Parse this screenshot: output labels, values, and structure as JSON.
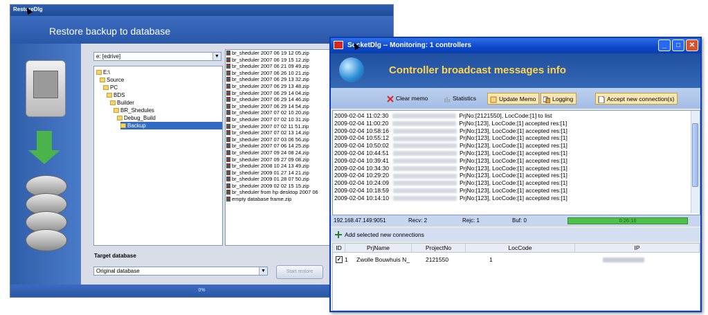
{
  "restore_window": {
    "title": "RestoreDlg",
    "header": "Restore backup to database",
    "drive_combo": "e: [edrive]",
    "tree": [
      {
        "label": "E:\\",
        "indent": 0,
        "selected": false
      },
      {
        "label": "Source",
        "indent": 1,
        "selected": false
      },
      {
        "label": "PC",
        "indent": 2,
        "selected": false
      },
      {
        "label": "BDS",
        "indent": 3,
        "selected": false
      },
      {
        "label": "Builder",
        "indent": 4,
        "selected": false
      },
      {
        "label": "BR_Shedules",
        "indent": 5,
        "selected": false
      },
      {
        "label": "Debug_Build",
        "indent": 6,
        "selected": false
      },
      {
        "label": "Backup",
        "indent": 7,
        "selected": true
      }
    ],
    "files": [
      "br_sheduler 2007 06 19 12 05.zip",
      "br_sheduler 2007 06 19 15 12.zip",
      "br_sheduler 2007 06 21 09 49.zip",
      "br_sheduler 2007 06 26 10 21.zip",
      "br_sheduler 2007 06 29 13 32.zip",
      "br_sheduler 2007 06 29 13 48.zip",
      "br_sheduler 2007 06 29 14 04.zip",
      "br_sheduler 2007 06 29 14 46.zip",
      "br_sheduler 2007 06 29 14 54.zip",
      "br_sheduler 2007 07 02 10 20.zip",
      "br_sheduler 2007 07 02 10 31.zip",
      "br_sheduler 2007 07 02 11 51.zip",
      "br_sheduler 2007 07 02 13 14.zip",
      "br_sheduler 2007 07 03 06 56.zip",
      "br_sheduler 2007 07 06 14 25.zip",
      "br_sheduler 2007 09 24 08 24.zip",
      "br_sheduler 2007 09 27 09 08.zip",
      "br_sheduler 2008 10 24 13 49.zip",
      "br_sheduler 2009 01 27 14 21.zip",
      "br_sheduler 2009 01 28 07 50.zip",
      "br_sheduler 2009 02 02 15 15.zip",
      "br_sheduler from hp desktop 2007 06",
      "empty database frame.zip"
    ],
    "target_label": "Target database",
    "target_value": "Original database",
    "start_button": "Start restore",
    "progress_text": "0%",
    "progress": 0
  },
  "socket_window": {
    "title": "SocketDlg -- Monitoring: 1 controllers",
    "header": "Controller broadcast messages info",
    "toolbar": {
      "clear": "Clear memo",
      "statistics": "Statistics",
      "update": "Update Memo",
      "logging": "Logging",
      "accept": "Accept new connection(s)"
    },
    "log": [
      {
        "time": "2009-02-04 11:02:30",
        "msg": "PrjNo:[2121550], LocCode:[1] to list"
      },
      {
        "time": "2009-02-04 11:00:20",
        "msg": "PrjNo:[123], LocCode:[1] accepted res:[1]"
      },
      {
        "time": "2009-02-04 10:58:16",
        "msg": "PrjNo:[123], LocCode:[1] accepted res:[1]"
      },
      {
        "time": "2009-02-04 10:55:12",
        "msg": "PrjNo:[123], LocCode:[1] accepted res:[1]"
      },
      {
        "time": "2009-02-04 10:50:02",
        "msg": "PrjNo:[123], LocCode:[1] accepted res:[1]"
      },
      {
        "time": "2009-02-04 10:44:51",
        "msg": "PrjNo:[123], LocCode:[1] accepted res:[1]"
      },
      {
        "time": "2009-02-04 10:39:41",
        "msg": "PrjNo:[123], LocCode:[1] accepted res:[1]"
      },
      {
        "time": "2009-02-04 10:34:30",
        "msg": "PrjNo:[123], LocCode:[1] accepted res:[1]"
      },
      {
        "time": "2009-02-04 10:29:20",
        "msg": "PrjNo:[123], LocCode:[1] accepted res:[1]"
      },
      {
        "time": "2009-02-04 10:24:09",
        "msg": "PrjNo:[123], LocCode:[1] accepted res:[1]"
      },
      {
        "time": "2009-02-04 10:18:59",
        "msg": "PrjNo:[123], LocCode:[1] accepted res:[1]"
      },
      {
        "time": "2009-02-04 10:14:10",
        "msg": "PrjNo:[123], LocCode:[1] accepted res:[1]"
      }
    ],
    "status": {
      "address": "192.168.47.149:9051",
      "recv": "Recv: 2",
      "rejc": "Rejc: 1",
      "buf": "Buf: 0",
      "timer": "0:26:16"
    },
    "add_button": "Add selected new connections",
    "columns": [
      "ID",
      "PrjName",
      "ProjectNo",
      "LocCode",
      "IP"
    ],
    "rows": [
      {
        "checked": true,
        "id": "1",
        "prjname": "Zwolle Bouwhuis N_",
        "projectno": "2121550",
        "loccode": "1"
      }
    ],
    "colors": {
      "title": "#0c47c9",
      "header_text": "#ffd54a",
      "progress": "#4fc04a"
    }
  }
}
